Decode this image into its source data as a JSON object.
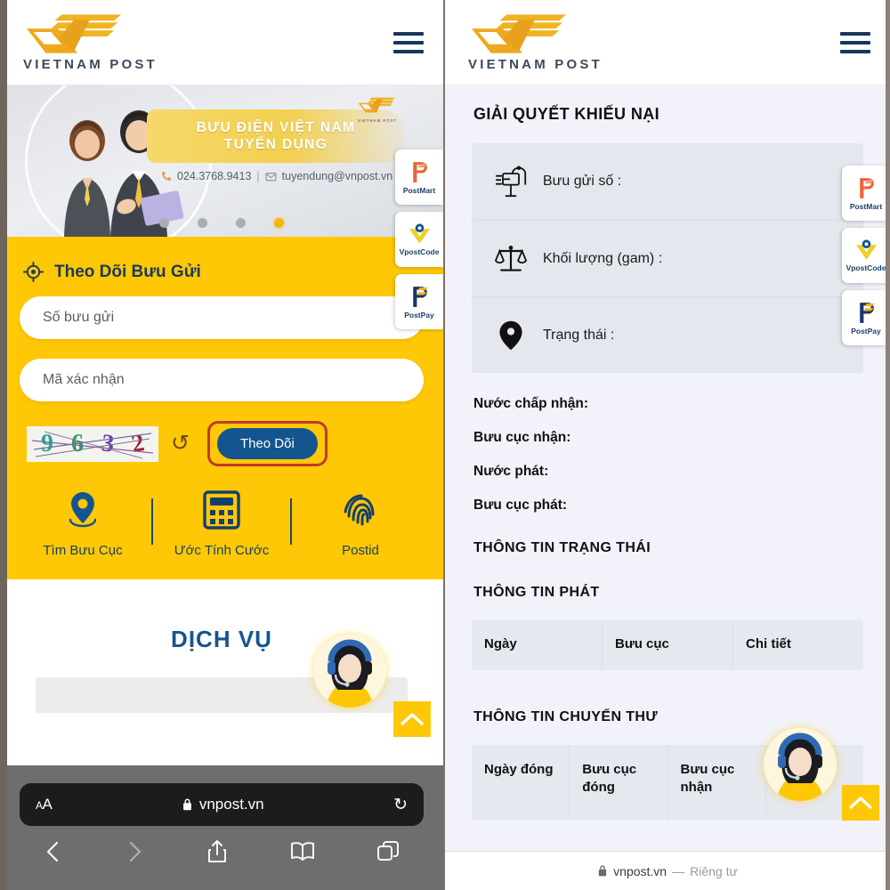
{
  "brand": {
    "logo_word": "VIETNAM POST",
    "mini_logo_word": "VIETNAM POST",
    "accent_yellow": "#ffc806",
    "accent_blue": "#14558f",
    "logo_gold": "#eeab1c"
  },
  "left_phone": {
    "header": {
      "menu_icon": "hamburger-icon"
    },
    "banner": {
      "title_line1": "BƯU ĐIỆN VIỆT NAM",
      "title_line2": "TUYỂN DỤNG",
      "phone": "024.3768.9413",
      "separator": "|",
      "email": "tuyendung@vnpost.vn",
      "dots_total": 4,
      "active_dot": 4
    },
    "tracking": {
      "section_title": "Theo Dõi Bưu Gửi",
      "target_icon": "crosshair-icon",
      "parcel_placeholder": "Số bưu gửi",
      "parcel_value": "",
      "captcha_placeholder": "Mã xác nhận",
      "captcha_value": "",
      "captcha_code": "9632",
      "captcha_digits": [
        "9",
        "6",
        "3",
        "2"
      ],
      "captcha_colors": [
        "#28a89a",
        "#2e9e5b",
        "#6b3fa0",
        "#9b2335"
      ],
      "refresh_icon": "refresh-icon",
      "submit_label": "Theo Dõi",
      "submit_highlight_color": "#c0392b"
    },
    "quick_links": [
      {
        "label": "Tìm Bưu Cục",
        "icon": "map-pin-icon"
      },
      {
        "label": "Ước Tính Cước",
        "icon": "calculator-icon"
      },
      {
        "label": "Postid",
        "icon": "fingerprint-icon"
      }
    ],
    "services": {
      "title": "DỊCH VỤ"
    },
    "side_badges": [
      {
        "label": "PostMart",
        "icon": "postmart-icon"
      },
      {
        "label": "VpostCode",
        "icon": "vpostcode-icon"
      },
      {
        "label": "PostPay",
        "icon": "postpay-icon"
      }
    ],
    "chat": {
      "icon": "support-agent-avatar"
    },
    "to_top": {
      "icon": "chevron-up-icon"
    },
    "browser": {
      "text_size_label": "AA",
      "lock_icon": "lock-icon",
      "url": "vnpost.vn",
      "reload_icon": "reload-icon",
      "back_icon": "chevron-left-icon",
      "forward_icon": "chevron-right-icon",
      "share_icon": "share-icon",
      "bookmarks_icon": "book-icon",
      "tabs_icon": "tabs-icon"
    }
  },
  "right_phone": {
    "header": {
      "menu_icon": "hamburger-icon"
    },
    "page_title": "GIẢI QUYẾT KHIẾU NẠI",
    "info_rows": [
      {
        "icon": "mailbox-icon",
        "label": "Bưu gửi số :",
        "value": ""
      },
      {
        "icon": "scale-icon",
        "label": "Khối lượng (gam) :",
        "value": ""
      },
      {
        "icon": "map-pin-icon",
        "label": "Trạng thái :",
        "value": ""
      }
    ],
    "fields": [
      {
        "label": "Nước chấp nhận:",
        "value": ""
      },
      {
        "label": "Bưu cục nhận:",
        "value": ""
      },
      {
        "label": "Nước phát:",
        "value": ""
      },
      {
        "label": "Bưu cục phát:",
        "value": ""
      }
    ],
    "sections": [
      {
        "title": "THÔNG TIN TRẠNG THÁI"
      },
      {
        "title": "THÔNG TIN PHÁT"
      },
      {
        "title": "THÔNG TIN CHUYỂN THƯ"
      }
    ],
    "delivery_table": {
      "columns": [
        "Ngày",
        "Bưu cục",
        "Chi tiết"
      ],
      "rows": []
    },
    "transfer_table": {
      "columns": [
        "Ngày đóng",
        "Bưu cục đóng",
        "Bưu cục nhận",
        "Bưu cục nhận"
      ],
      "rows": []
    },
    "side_badges": [
      {
        "label": "PostMart",
        "icon": "postmart-icon"
      },
      {
        "label": "VpostCode",
        "icon": "vpostcode-icon"
      },
      {
        "label": "PostPay",
        "icon": "postpay-icon"
      }
    ],
    "chat": {
      "icon": "support-agent-avatar"
    },
    "to_top": {
      "icon": "chevron-up-icon"
    },
    "footer": {
      "lock_icon": "lock-icon",
      "url": "vnpost.vn",
      "dash": "—",
      "privacy": "Riêng tư"
    }
  }
}
